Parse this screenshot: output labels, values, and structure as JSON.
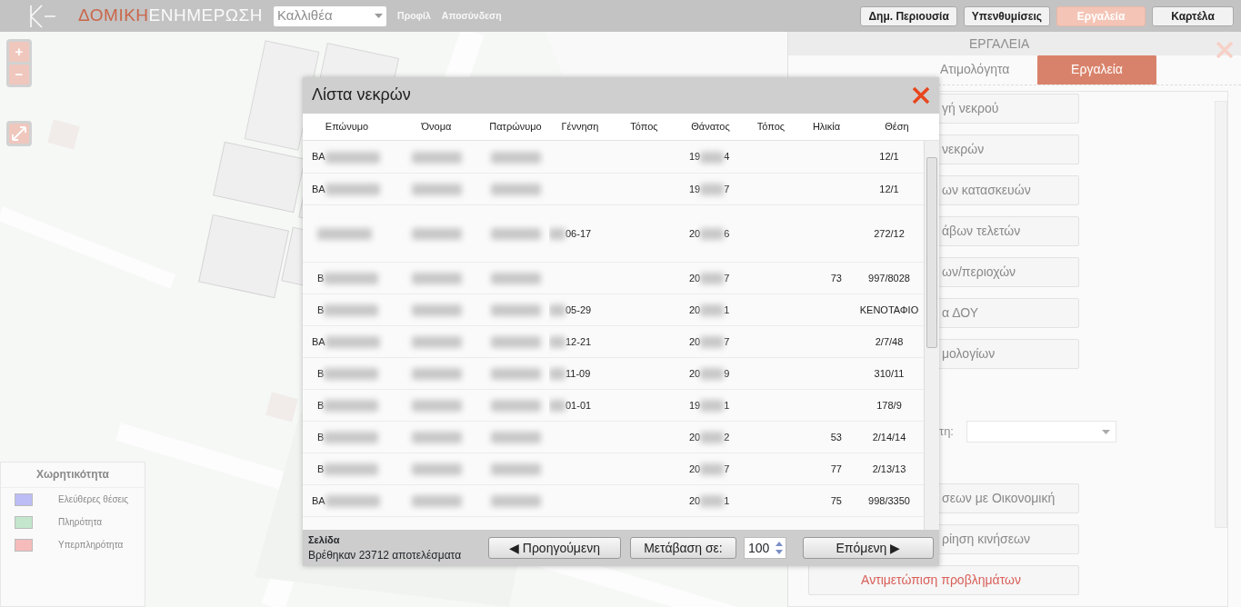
{
  "navbar": {
    "brand": {
      "first": "ΔΟΜΙΚΗ",
      "second": "ΕΝΗΜΕΡΩΣΗ"
    },
    "area_select": {
      "value": "Καλλιθέα"
    },
    "links": [
      "Προφίλ",
      "Αποσύνδεση"
    ],
    "buttons": [
      {
        "label": "Δημ. Περιουσία",
        "selected": false
      },
      {
        "label": "Υπενθυμίσεις",
        "selected": false
      },
      {
        "label": "Εργαλεία",
        "selected": true
      },
      {
        "label": "Καρτέλα",
        "selected": false
      }
    ]
  },
  "map": {
    "kind": "picture",
    "zoom_in": "+",
    "zoom_out": "−",
    "legend": {
      "title": "Χωρητικότητα",
      "items": [
        {
          "label": "Ελεύθερες θέσεις",
          "color": "#bcbcf6"
        },
        {
          "label": "Πληρότητα",
          "color": "#c3e6cc"
        },
        {
          "label": "Υπερπληρότητα",
          "color": "#f6bcbc"
        }
      ]
    }
  },
  "tools_panel": {
    "title": "ΕΡΓΑΛΕΙΑ",
    "tabs": [
      {
        "label": "Ατιμολόγητα",
        "selected": false
      },
      {
        "label": "Εργαλεία",
        "selected": true
      }
    ],
    "buttons_top": [
      "γή νεκρού",
      "νεκρών",
      "ων κατασκευών",
      "άβων τελετών",
      "ων/περιοχών",
      "α ΔΟΥ",
      "μολογίων"
    ],
    "field_label": "τη:",
    "buttons_bottom": [
      {
        "label": "σεων με Οικονομική",
        "kind": "partial"
      },
      {
        "label": "ρίηση κινήσεων",
        "kind": "partial"
      },
      {
        "label": "Αντιμετώπιση προβλημάτων",
        "kind": "warning"
      }
    ]
  },
  "modal": {
    "title": "Λίστα νεκρών",
    "columns": [
      "Επώνυμο",
      "Όνομα",
      "Πατρώνυμο",
      "Γέννηση",
      "Τόπος",
      "Θάνατος",
      "Τόπος",
      "Ηλικία",
      "Θέση"
    ],
    "rows": [
      {
        "surname": "ΒΑ",
        "death_start": "19",
        "death_end": "4",
        "position": "12/1"
      },
      {
        "surname": "ΒΑ",
        "death_start": "19",
        "death_end": "7",
        "position": "12/1"
      },
      {
        "birth": "06-17",
        "death_start": "20",
        "death_end": "6",
        "position": "272/12"
      },
      {
        "surname": "Β",
        "death_start": "20",
        "death_end": "7",
        "age": "73",
        "position": "997/8028"
      },
      {
        "surname": "Β",
        "birth": "05-29",
        "death_start": "20",
        "death_end": "1",
        "position": "ΚΕΝΟΤΑΦΙΟ"
      },
      {
        "surname": "ΒΑ",
        "birth": "12-21",
        "death_start": "20",
        "death_end": "7",
        "position": "2/7/48"
      },
      {
        "surname": "Β",
        "birth": "11-09",
        "death_start": "20",
        "death_end": "9",
        "position": "310/11"
      },
      {
        "surname": "Β",
        "birth": "01-01",
        "death_start": "19",
        "death_end": "1",
        "position": "178/9"
      },
      {
        "surname": "Β",
        "death_start": "20",
        "death_end": "2",
        "age": "53",
        "position": "2/14/14"
      },
      {
        "surname": "Β",
        "death_start": "20",
        "death_end": "7",
        "age": "77",
        "position": "2/13/13"
      },
      {
        "surname": "ΒΑ",
        "death_start": "20",
        "death_end": "1",
        "age": "75",
        "position": "998/3350"
      }
    ],
    "footer": {
      "page_info": "Σελίδα",
      "results": "Βρέθηκαν 23712 αποτελέσματα",
      "prev": "◀ Προηγούμενη",
      "goto": "Μετάβαση σε:",
      "page_input": "100",
      "next": "Επόμενη ▶"
    }
  }
}
